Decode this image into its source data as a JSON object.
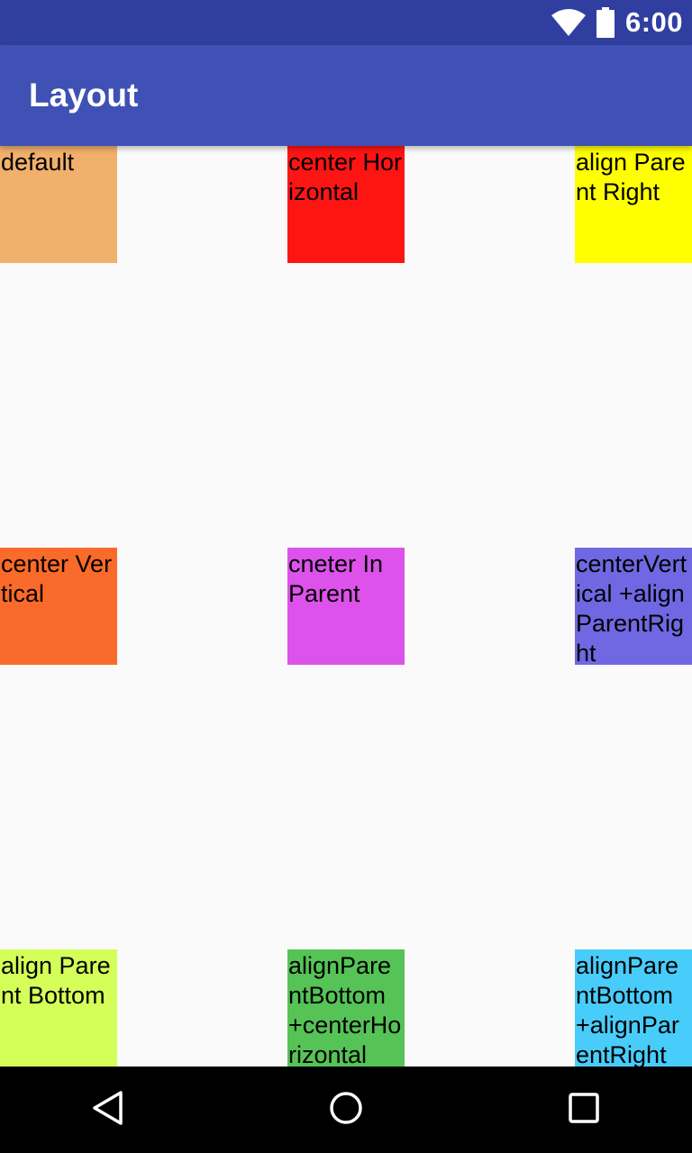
{
  "status_bar": {
    "time": "6:00",
    "icons": [
      "wifi-icon",
      "battery-icon"
    ],
    "background": "#303f9f"
  },
  "app_bar": {
    "title": "Layout",
    "background": "#3f51b5"
  },
  "boxes": [
    {
      "id": "default",
      "label": "default",
      "color": "#f1b06b"
    },
    {
      "id": "center-horizontal",
      "label": "center Horizontal",
      "color": "#ff1414"
    },
    {
      "id": "align-parent-right",
      "label": "align Parent Right",
      "color": "#ffff00"
    },
    {
      "id": "center-vertical",
      "label": "center Vertical",
      "color": "#fa6a2a"
    },
    {
      "id": "center-in-parent",
      "label": "cneter In Parent",
      "color": "#dc52ea"
    },
    {
      "id": "center-vertical-align-parent-right",
      "label": "centerVertical +alignParentRight",
      "color": "#7068e2"
    },
    {
      "id": "align-parent-bottom",
      "label": "align Parent Bottom",
      "color": "#d4fe58"
    },
    {
      "id": "align-parent-bottom-center-horizontal",
      "label": "alignParentBottom +centerHorizontal",
      "color": "#56c356"
    },
    {
      "id": "align-parent-bottom-align-parent-right",
      "label": "alignParentBottom +alignParentRight",
      "color": "#48cdfa"
    }
  ],
  "nav_bar": {
    "buttons": [
      "back-icon",
      "home-icon",
      "recents-icon"
    ]
  }
}
